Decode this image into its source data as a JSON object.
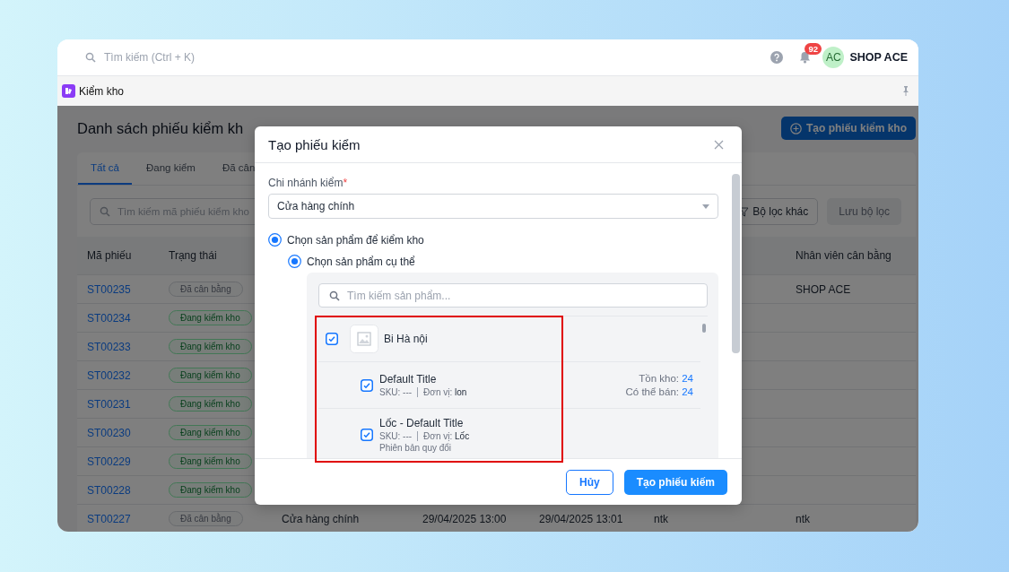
{
  "topbar": {
    "search": {
      "placeholder": "Tìm kiếm (Ctrl + K)"
    },
    "notifications": {
      "badge": "92"
    },
    "avatar": {
      "initials": "AC"
    },
    "account": "SHOP ACE"
  },
  "app_tab": {
    "label": "Kiểm kho"
  },
  "page": {
    "title": "Danh sách phiếu kiểm kh",
    "create_button": "Tạo phiếu kiểm kho",
    "tabs": [
      {
        "label": "Tất cả",
        "selected": true
      },
      {
        "label": "Đang kiểm",
        "selected": false
      },
      {
        "label": "Đã cân",
        "selected": false
      }
    ],
    "search": {
      "placeholder": "Tìm kiếm mã phiếu kiểm kho"
    },
    "filter_button": "Bộ lọc khác",
    "save_filter_button": "Lưu bộ lọc",
    "table": {
      "header": {
        "code": "Mã phiếu",
        "status": "Trạng thái",
        "balancer": "Nhân viên cân bằng"
      },
      "rows": [
        {
          "code": "ST00235",
          "status": {
            "label": "Đã cân bằng",
            "kind": "balanced"
          },
          "balancer": "SHOP ACE"
        },
        {
          "code": "ST00234",
          "status": {
            "label": "Đang kiểm kho",
            "kind": "checking"
          }
        },
        {
          "code": "ST00233",
          "status": {
            "label": "Đang kiểm kho",
            "kind": "checking"
          }
        },
        {
          "code": "ST00232",
          "status": {
            "label": "Đang kiểm kho",
            "kind": "checking"
          }
        },
        {
          "code": "ST00231",
          "status": {
            "label": "Đang kiểm kho",
            "kind": "checking"
          }
        },
        {
          "code": "ST00230",
          "status": {
            "label": "Đang kiểm kho",
            "kind": "checking"
          }
        },
        {
          "code": "ST00229",
          "status": {
            "label": "Đang kiểm kho",
            "kind": "checking"
          }
        },
        {
          "code": "ST00228",
          "status": {
            "label": "Đang kiểm kho",
            "kind": "checking"
          }
        },
        {
          "code": "ST00227",
          "status": {
            "label": "Đã cân bằng",
            "kind": "balanced"
          },
          "branch": "Cửa hàng chính",
          "column_4": "29/04/2025 13:00",
          "column_5": "29/04/2025 13:01",
          "column_6": "ntk",
          "balancer": "ntk"
        }
      ]
    }
  },
  "modal": {
    "title": "Tạo phiếu kiểm",
    "branch_field": {
      "label": "Chi nhánh kiểm",
      "required_mark": "*",
      "value": "Cửa hàng chính"
    },
    "options": [
      {
        "label": "Chọn sản phẩm để kiểm kho",
        "selected": true,
        "children": [
          {
            "label": "Chọn sản phẩm cụ thể",
            "selected": true
          }
        ]
      }
    ],
    "product_search": {
      "placeholder": "Tìm kiếm sản phẩm..."
    },
    "products": [
      {
        "name": "Bi Hà nội",
        "checked": true,
        "highlighted": true,
        "variants": [
          {
            "title": "Default Title",
            "checked": true,
            "sku": "SKU: ---",
            "unit": "Đơn vị: **lon**",
            "stock_label": "Tồn kho:",
            "stock": "24",
            "available_label": "Có thể bán:",
            "available": "24"
          },
          {
            "title": "Lốc - Default Title",
            "checked": true,
            "sku": "SKU: ---",
            "unit": "Đơn vị: **Lốc**",
            "note": "Phiên bản quy đổi"
          }
        ]
      }
    ],
    "buttons": [
      {
        "label": "Hủy",
        "kind": "secondary"
      },
      {
        "label": "Tạo phiếu kiếm",
        "kind": "primary"
      }
    ]
  }
}
